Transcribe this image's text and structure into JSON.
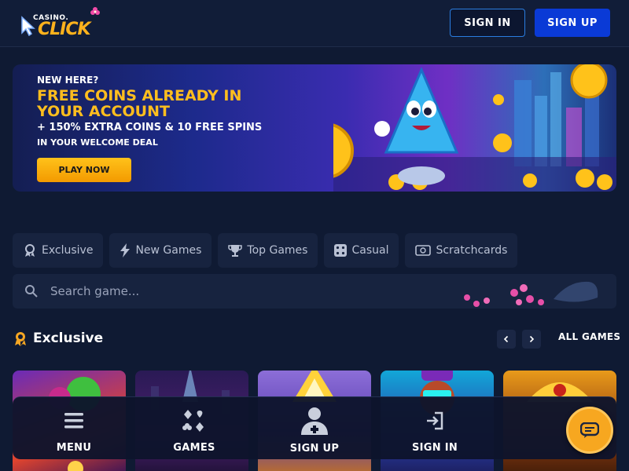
{
  "header": {
    "logo_small": "CASINO.",
    "logo_big": "CLICK",
    "signin_label": "SIGN IN",
    "signup_label": "SIGN UP"
  },
  "banner": {
    "line1": "NEW HERE?",
    "line2": "FREE COINS ALREADY IN YOUR ACCOUNT",
    "line3": "+ 150% EXTRA COINS & 10 FREE SPINS",
    "line4": "IN YOUR WELCOME DEAL",
    "cta": "PLAY NOW"
  },
  "tabs": [
    {
      "label": "Exclusive",
      "icon": "award-icon"
    },
    {
      "label": "New Games",
      "icon": "lightning-icon"
    },
    {
      "label": "Top Games",
      "icon": "trophy-icon"
    },
    {
      "label": "Casual",
      "icon": "dice-icon"
    },
    {
      "label": "Scratchcards",
      "icon": "ticket-icon"
    }
  ],
  "search": {
    "placeholder": "Search game..."
  },
  "section": {
    "title": "Exclusive",
    "all_games": "ALL GAMES"
  },
  "bottom_nav": [
    {
      "label": "MENU",
      "icon": "menu-icon"
    },
    {
      "label": "GAMES",
      "icon": "cards-suits-icon"
    },
    {
      "label": "SIGN UP",
      "icon": "add-user-icon"
    },
    {
      "label": "SIGN IN",
      "icon": "sign-in-icon"
    }
  ],
  "colors": {
    "background": "#0f1a33",
    "accent_gold": "#ffbe1e",
    "primary_blue": "#0a3ad6",
    "chat_orange": "#f7a720"
  }
}
